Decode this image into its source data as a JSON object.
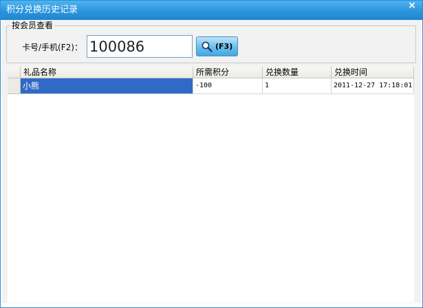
{
  "window": {
    "title": "积分兑换历史记录",
    "close_label": "×"
  },
  "member_lookup": {
    "legend": "按会员查看",
    "card_label": "卡号/手机(F2)：",
    "card_value": "100086",
    "search_button": {
      "label": "(F3)",
      "icon": "search-icon"
    }
  },
  "grid": {
    "columns": [
      "礼品名称",
      "所需积分",
      "兑换数量",
      "兑换时间"
    ],
    "rows": [
      [
        "小熊",
        "-100",
        "1",
        "2011-12-27 17:18:01"
      ]
    ],
    "selected_color": "#316ac5"
  },
  "colors": {
    "titlebar": "#2a95de",
    "client_bg": "#f2f2f2"
  }
}
